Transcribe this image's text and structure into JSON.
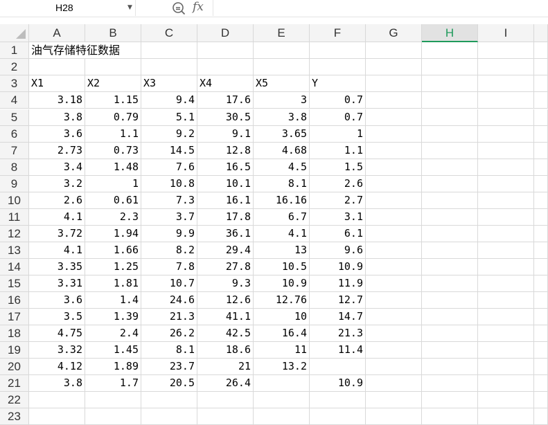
{
  "formula_bar": {
    "name_box": "H28",
    "zoom_icon": "zoom-formula-icon",
    "fx_label": "fx",
    "formula": ""
  },
  "columns": [
    "A",
    "B",
    "C",
    "D",
    "E",
    "F",
    "G",
    "H",
    "I"
  ],
  "selected_column": "H",
  "rows": [
    {
      "n": "1",
      "cells": [
        "油气存储特征数据",
        "",
        "",
        "",
        "",
        "",
        "",
        "",
        ""
      ]
    },
    {
      "n": "2",
      "cells": [
        "",
        "",
        "",
        "",
        "",
        "",
        "",
        "",
        ""
      ]
    },
    {
      "n": "3",
      "cells": [
        "X1",
        "X2",
        "X3",
        "X4",
        "X5",
        "Y",
        "",
        "",
        ""
      ]
    },
    {
      "n": "4",
      "cells": [
        "3.18",
        "1.15",
        "9.4",
        "17.6",
        "3",
        "0.7",
        "",
        "",
        ""
      ]
    },
    {
      "n": "5",
      "cells": [
        "3.8",
        "0.79",
        "5.1",
        "30.5",
        "3.8",
        "0.7",
        "",
        "",
        ""
      ]
    },
    {
      "n": "6",
      "cells": [
        "3.6",
        "1.1",
        "9.2",
        "9.1",
        "3.65",
        "1",
        "",
        "",
        ""
      ]
    },
    {
      "n": "7",
      "cells": [
        "2.73",
        "0.73",
        "14.5",
        "12.8",
        "4.68",
        "1.1",
        "",
        "",
        ""
      ]
    },
    {
      "n": "8",
      "cells": [
        "3.4",
        "1.48",
        "7.6",
        "16.5",
        "4.5",
        "1.5",
        "",
        "",
        ""
      ]
    },
    {
      "n": "9",
      "cells": [
        "3.2",
        "1",
        "10.8",
        "10.1",
        "8.1",
        "2.6",
        "",
        "",
        ""
      ]
    },
    {
      "n": "10",
      "cells": [
        "2.6",
        "0.61",
        "7.3",
        "16.1",
        "16.16",
        "2.7",
        "",
        "",
        ""
      ]
    },
    {
      "n": "11",
      "cells": [
        "4.1",
        "2.3",
        "3.7",
        "17.8",
        "6.7",
        "3.1",
        "",
        "",
        ""
      ]
    },
    {
      "n": "12",
      "cells": [
        "3.72",
        "1.94",
        "9.9",
        "36.1",
        "4.1",
        "6.1",
        "",
        "",
        ""
      ]
    },
    {
      "n": "13",
      "cells": [
        "4.1",
        "1.66",
        "8.2",
        "29.4",
        "13",
        "9.6",
        "",
        "",
        ""
      ]
    },
    {
      "n": "14",
      "cells": [
        "3.35",
        "1.25",
        "7.8",
        "27.8",
        "10.5",
        "10.9",
        "",
        "",
        ""
      ]
    },
    {
      "n": "15",
      "cells": [
        "3.31",
        "1.81",
        "10.7",
        "9.3",
        "10.9",
        "11.9",
        "",
        "",
        ""
      ]
    },
    {
      "n": "16",
      "cells": [
        "3.6",
        "1.4",
        "24.6",
        "12.6",
        "12.76",
        "12.7",
        "",
        "",
        ""
      ]
    },
    {
      "n": "17",
      "cells": [
        "3.5",
        "1.39",
        "21.3",
        "41.1",
        "10",
        "14.7",
        "",
        "",
        ""
      ]
    },
    {
      "n": "18",
      "cells": [
        "4.75",
        "2.4",
        "26.2",
        "42.5",
        "16.4",
        "21.3",
        "",
        "",
        ""
      ]
    },
    {
      "n": "19",
      "cells": [
        "3.32",
        "1.45",
        "8.1",
        "18.6",
        "11",
        "11.4",
        "",
        "",
        ""
      ]
    },
    {
      "n": "20",
      "cells": [
        "4.12",
        "1.89",
        "23.7",
        "21",
        "13.2",
        "",
        "",
        "",
        ""
      ]
    },
    {
      "n": "21",
      "cells": [
        "3.8",
        "1.7",
        "20.5",
        "26.4",
        "",
        "10.9",
        "",
        "",
        ""
      ]
    },
    {
      "n": "22",
      "cells": [
        "",
        "",
        "",
        "",
        "",
        "",
        "",
        "",
        ""
      ]
    },
    {
      "n": "23",
      "cells": [
        "",
        "",
        "",
        "",
        "",
        "",
        "",
        "",
        ""
      ]
    }
  ]
}
